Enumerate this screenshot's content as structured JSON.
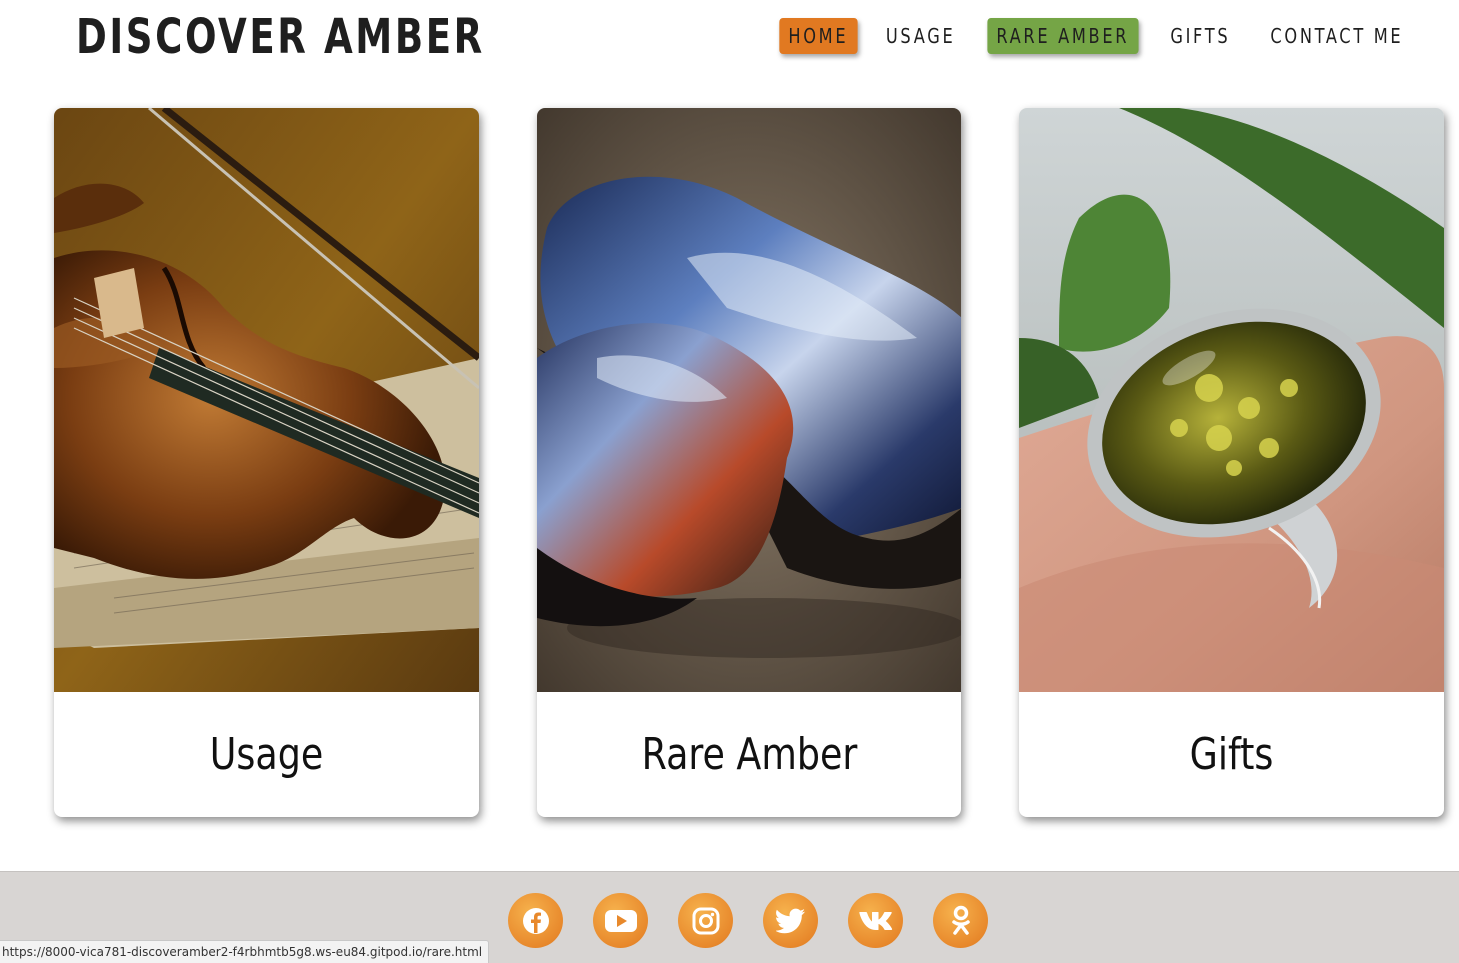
{
  "brand": {
    "title": "DISCOVER AMBER"
  },
  "nav": {
    "items": [
      {
        "label": "HOME",
        "color": "#e17921"
      },
      {
        "label": "USAGE"
      },
      {
        "label": "RARE AMBER",
        "color": "#75a546"
      },
      {
        "label": "GIFTS"
      },
      {
        "label": "CONTACT ME"
      }
    ]
  },
  "cards": [
    {
      "title": "Usage",
      "image": "violin-on-sheet-music"
    },
    {
      "title": "Rare Amber",
      "image": "blue-amber-stones"
    },
    {
      "title": "Gifts",
      "image": "amber-ring-on-hand"
    }
  ],
  "footer": {
    "socials": [
      "facebook-icon",
      "youtube-icon",
      "instagram-icon",
      "twitter-icon",
      "vk-icon",
      "odnoklassniki-icon"
    ],
    "accent": "#e8892c"
  },
  "status_bar": {
    "url": "https://8000-vica781-discoveramber2-f4rbhmtb5g8.ws-eu84.gitpod.io/rare.html"
  }
}
